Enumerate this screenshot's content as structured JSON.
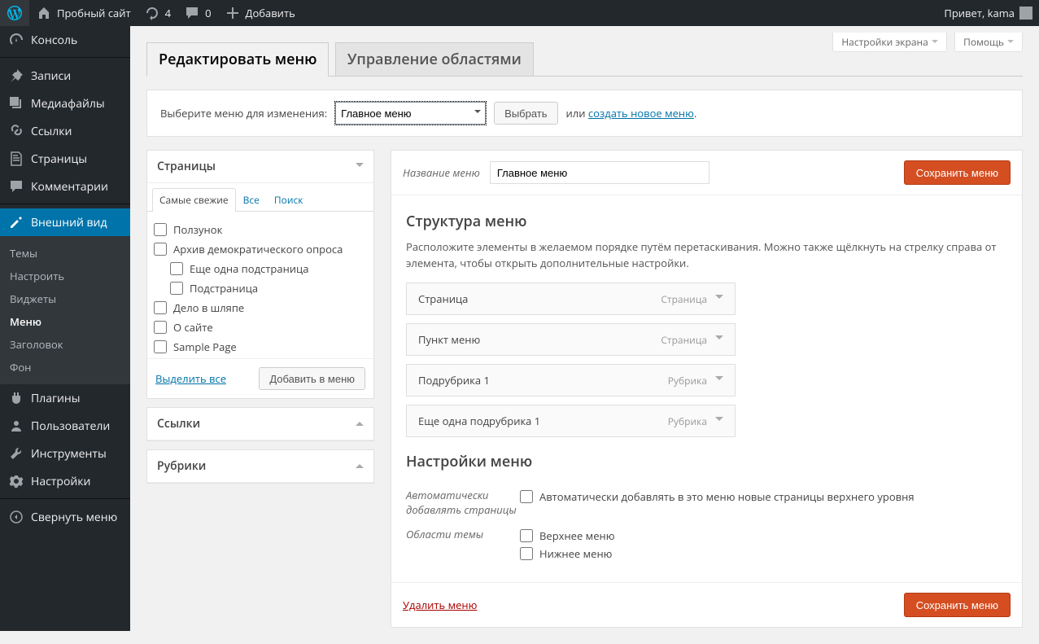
{
  "toolbar": {
    "site_name": "Пробный сайт",
    "updates": "4",
    "comments": "0",
    "add_new": "Добавить",
    "greeting": "Привет, kama"
  },
  "sidebar": {
    "items": [
      {
        "label": "Консоль"
      },
      {
        "label": "Записи"
      },
      {
        "label": "Медиафайлы"
      },
      {
        "label": "Ссылки"
      },
      {
        "label": "Страницы"
      },
      {
        "label": "Комментарии"
      },
      {
        "label": "Внешний вид"
      },
      {
        "label": "Плагины"
      },
      {
        "label": "Пользователи"
      },
      {
        "label": "Инструменты"
      },
      {
        "label": "Настройки"
      }
    ],
    "submenu": [
      {
        "label": "Темы"
      },
      {
        "label": "Настроить"
      },
      {
        "label": "Виджеты"
      },
      {
        "label": "Меню"
      },
      {
        "label": "Заголовок"
      },
      {
        "label": "Фон"
      }
    ],
    "collapse": "Свернуть меню"
  },
  "screen": {
    "options": "Настройки экрана",
    "help": "Помощь"
  },
  "tabs": {
    "edit": "Редактировать меню",
    "manage": "Управление областями"
  },
  "selector": {
    "prompt": "Выберите меню для изменения:",
    "selected": "Главное меню",
    "choose_btn": "Выбрать",
    "or": "или",
    "create_link": "создать новое меню",
    "dot": "."
  },
  "left": {
    "pages": {
      "title": "Страницы",
      "tab_recent": "Самые свежие",
      "tab_all": "Все",
      "tab_search": "Поиск",
      "items": [
        {
          "label": "Ползунок",
          "indent": false
        },
        {
          "label": "Архив демократического опроса",
          "indent": false
        },
        {
          "label": "Еще одна подстраница",
          "indent": true
        },
        {
          "label": "Подстраница",
          "indent": true
        },
        {
          "label": "Дело в шляпе",
          "indent": false
        },
        {
          "label": "О сайте",
          "indent": false
        },
        {
          "label": "Sample Page",
          "indent": false
        }
      ],
      "select_all": "Выделить все",
      "add_btn": "Добавить в меню"
    },
    "links": {
      "title": "Ссылки"
    },
    "cats": {
      "title": "Рубрики"
    }
  },
  "right": {
    "name_label": "Название меню",
    "name_value": "Главное меню",
    "save_btn": "Сохранить меню",
    "structure_h": "Структура меню",
    "structure_p": "Расположите элементы в желаемом порядке путём перетаскивания. Можно также щёлкнуть на стрелку справа от элемента, чтобы открыть дополнительные настройки.",
    "items": [
      {
        "title": "Страница",
        "type": "Страница"
      },
      {
        "title": "Пункт меню",
        "type": "Страница"
      },
      {
        "title": "Подрубрика 1",
        "type": "Рубрика"
      },
      {
        "title": "Еще одна подрубрика 1",
        "type": "Рубрика"
      }
    ],
    "settings_h": "Настройки меню",
    "auto_label": "Автоматически добавлять страницы",
    "auto_opt": "Автоматически добавлять в это меню новые страницы верхнего уровня",
    "locations_label": "Области темы",
    "loc_top": "Верхнее меню",
    "loc_bottom": "Нижнее меню",
    "delete": "Удалить меню"
  }
}
